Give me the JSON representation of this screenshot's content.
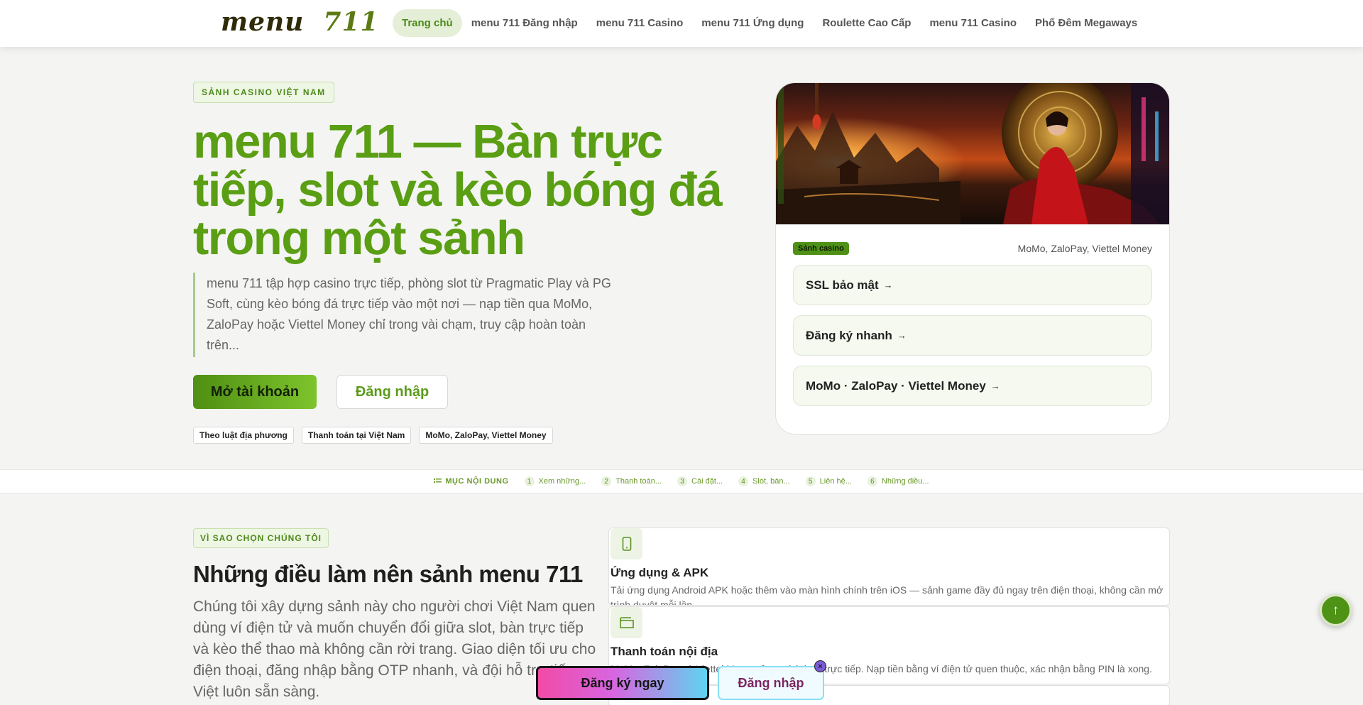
{
  "header": {
    "logo_word": "menu",
    "logo_num": "711",
    "nav": [
      {
        "label": "Trang chủ",
        "active": true
      },
      {
        "label": "menu 711 Đăng nhập"
      },
      {
        "label": "menu 711 Casino"
      },
      {
        "label": "menu 711 Ứng dụng"
      },
      {
        "label": "Roulette Cao Cấp"
      },
      {
        "label": "menu 711 Casino"
      },
      {
        "label": "Phố Đêm Megaways"
      }
    ]
  },
  "hero": {
    "eyebrow": "SẢNH CASINO VIỆT NAM",
    "title": "menu 711 — Bàn trực tiếp, slot và kèo bóng đá trong một sảnh",
    "lead": "menu 711 tập hợp casino trực tiếp, phòng slot từ Pragmatic Play và PG Soft, cùng kèo bóng đá trực tiếp vào một nơi — nạp tiền qua MoMo, ZaloPay hoặc Viettel Money chỉ trong vài chạm, truy cập hoàn toàn trên...",
    "primary_btn": "Mở tài khoản",
    "secondary_btn": "Đăng nhập",
    "chips": [
      "Theo luật địa phương",
      "Thanh toán tại Việt Nam",
      "MoMo, ZaloPay, Viettel Money"
    ]
  },
  "hero_card": {
    "badge": "Sảnh casino",
    "payments": "MoMo, ZaloPay, Viettel Money",
    "features": [
      "SSL bảo mật",
      "Đăng ký nhanh",
      "MoMo · ZaloPay · Viettel Money"
    ],
    "arrow": "→"
  },
  "toc": {
    "label": "MỤC NỘI DUNG",
    "items": [
      {
        "n": "1",
        "t": "Xem những..."
      },
      {
        "n": "2",
        "t": "Thanh toán..."
      },
      {
        "n": "3",
        "t": "Cài đặt..."
      },
      {
        "n": "4",
        "t": "Slot, bàn..."
      },
      {
        "n": "5",
        "t": "Liên hệ..."
      },
      {
        "n": "6",
        "t": "Những điều..."
      }
    ]
  },
  "why": {
    "eyebrow": "VÌ SAO CHỌN CHÚNG TÔI",
    "title": "Những điều làm nên sảnh menu 711",
    "body": "Chúng tôi xây dựng sảnh này cho người chơi Việt Nam quen dùng ví điện tử và muốn chuyển đổi giữa slot, bàn trực tiếp và kèo thể thao mà không cần rời trang. Giao diện tối ưu cho điện thoại, đăng nhập bằng OTP nhanh, và đội hỗ trợ tiếng Việt luôn sẵn sàng."
  },
  "features": [
    {
      "icon": "phone-icon",
      "title": "Ứng dụng & APK",
      "desc": "Tải ứng dụng Android APK hoặc thêm vào màn hình chính trên iOS — sảnh game đầy đủ ngay trên điện thoại, không cần mở trình duyệt mỗi lần."
    },
    {
      "icon": "wallet-icon",
      "title": "Thanh toán nội địa",
      "desc": "MoMo, ZaloPay và Viettel Money được tích hợp trực tiếp. Nạp tiền bằng ví điện tử quen thuộc, xác nhận bằng PIN là xong."
    }
  ],
  "cta": {
    "register": "Đăng ký ngay",
    "login": "Đăng nhập",
    "close": "×"
  },
  "scroll_top": "↑",
  "colors": {
    "accent": "#5a9e14",
    "accent_light": "#7dc42c",
    "cta_pink": "#f24aa6",
    "cta_cyan": "#5ed4ef"
  }
}
